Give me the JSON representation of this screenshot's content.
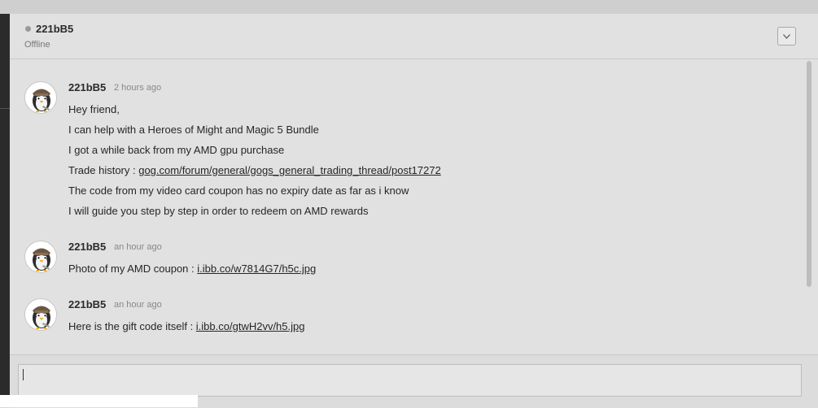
{
  "header": {
    "username": "221bB5",
    "status": "Offline",
    "status_color": "#9a9a9a",
    "collapse_icon": "chevron-down-icon"
  },
  "messages": [
    {
      "author": "221bB5",
      "time": "2 hours ago",
      "avatar_icon": "penguin-avatar-icon",
      "lines": [
        {
          "text": "Hey friend,"
        },
        {
          "text": "I can help with a Heroes of Might and Magic 5 Bundle"
        },
        {
          "text": "I got a while back from my AMD gpu purchase"
        },
        {
          "text": "Trade history : ",
          "link": "gog.com/forum/general/gogs_general_trading_thread/post17272"
        },
        {
          "text": "The code from my video card coupon has no expiry date as far as i know"
        },
        {
          "text": "I will guide you step by step in order to redeem on AMD rewards"
        }
      ]
    },
    {
      "author": "221bB5",
      "time": "an hour ago",
      "avatar_icon": "penguin-avatar-icon",
      "lines": [
        {
          "text": "Photo of my AMD coupon : ",
          "link": "i.ibb.co/w7814G7/h5c.jpg"
        }
      ]
    },
    {
      "author": "221bB5",
      "time": "an hour ago",
      "avatar_icon": "penguin-avatar-icon",
      "lines": [
        {
          "text": "Here is the gift code itself : ",
          "link": "i.ibb.co/gtwH2vv/h5.jpg"
        }
      ]
    }
  ],
  "composer": {
    "value": "",
    "placeholder": ""
  }
}
